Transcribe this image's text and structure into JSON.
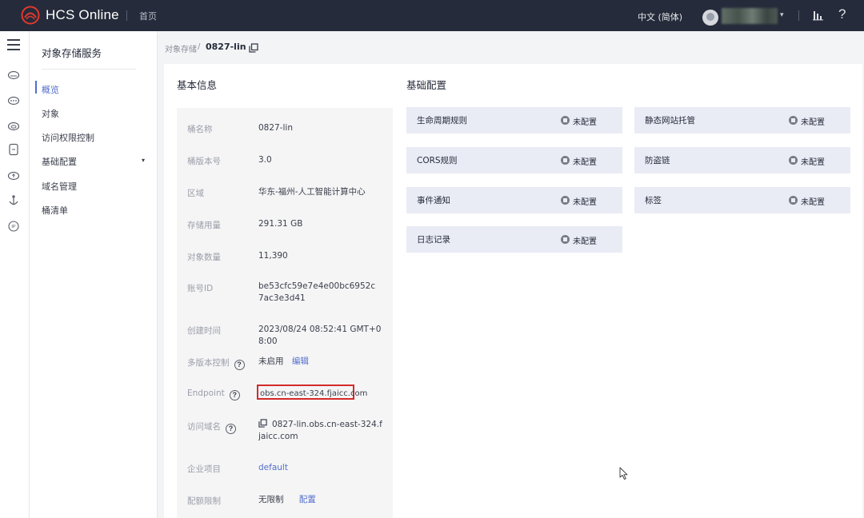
{
  "topbar": {
    "brand": "HCS Online",
    "home": "首页",
    "language": "中文 (简体)",
    "user_caret": "▾",
    "help": "?"
  },
  "sidebar": {
    "title": "对象存储服务",
    "items": [
      {
        "label": "概览",
        "active": true
      },
      {
        "label": "对象"
      },
      {
        "label": "访问权限控制"
      },
      {
        "label": "基础配置",
        "caret": "▾"
      },
      {
        "label": "域名管理"
      },
      {
        "label": "桶清单"
      }
    ]
  },
  "breadcrumb": {
    "parent": "对象存储",
    "separator": "/",
    "current": "0827-lin"
  },
  "basic_info": {
    "title": "基本信息",
    "rows": [
      {
        "label": "桶名称",
        "value": "0827-lin"
      },
      {
        "label": "桶版本号",
        "value": "3.0"
      },
      {
        "label": "区域",
        "value": "华东-福州-人工智能计算中心"
      },
      {
        "label": "存储用量",
        "value": "291.31 GB"
      },
      {
        "label": "对象数量",
        "value": "11,390"
      },
      {
        "label": "账号ID",
        "value": "be53cfc59e7e4e00bc6952c7ac3e3d41"
      },
      {
        "label": "创建时间",
        "value": "2023/08/24 08:52:41 GMT+08:00"
      },
      {
        "label": "多版本控制",
        "value": "未启用",
        "link": "编辑",
        "help": "?"
      },
      {
        "label": "Endpoint",
        "value": "obs.cn-east-324.fjaicc.com",
        "help": "?"
      },
      {
        "label": "访问域名",
        "value": "0827-lin.obs.cn-east-324.fjaicc.com",
        "help": "?"
      },
      {
        "label": "企业项目",
        "value": "default"
      },
      {
        "label": "配额限制",
        "value": "无限制",
        "link": "配置"
      }
    ]
  },
  "basic_config": {
    "title": "基础配置",
    "tiles": [
      {
        "name": "生命周期规则",
        "status": "未配置"
      },
      {
        "name": "静态网站托管",
        "status": "未配置"
      },
      {
        "name": "CORS规则",
        "status": "未配置"
      },
      {
        "name": "防盗链",
        "status": "未配置"
      },
      {
        "name": "事件通知",
        "status": "未配置"
      },
      {
        "name": "标签",
        "status": "未配置"
      },
      {
        "name": "日志记录",
        "status": "未配置"
      }
    ]
  },
  "colors": {
    "topbar": "#252b3a",
    "accent": "#526ecc",
    "highlight_box": "#d42a2a",
    "tile_bg": "#e9ecf5"
  }
}
